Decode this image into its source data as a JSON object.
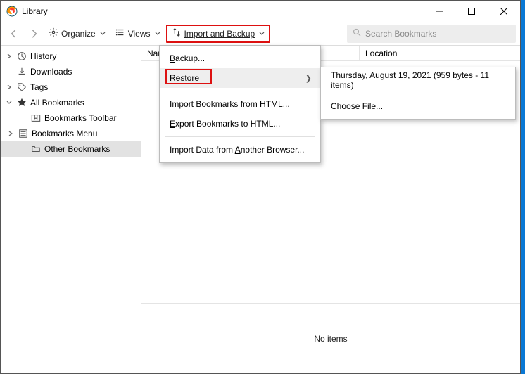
{
  "window": {
    "title": "Library"
  },
  "toolbar": {
    "organize": "Organize",
    "views": "Views",
    "import_backup": "Import and Backup",
    "search_placeholder": "Search Bookmarks"
  },
  "sidebar": {
    "history": "History",
    "downloads": "Downloads",
    "tags": "Tags",
    "all_bookmarks": "All Bookmarks",
    "bm_toolbar": "Bookmarks Toolbar",
    "bm_menu": "Bookmarks Menu",
    "other_bm": "Other Bookmarks"
  },
  "columns": {
    "name": "Name",
    "location": "Location"
  },
  "empty_text": "No items",
  "menu1": {
    "backup": "Backup...",
    "restore": "Restore",
    "import_html": "Import Bookmarks from HTML...",
    "export_html": "Export Bookmarks to HTML...",
    "import_other": "Import Data from Another Browser..."
  },
  "menu2": {
    "entry": "Thursday, August 19, 2021 (959 bytes - 11 items)",
    "choose": "Choose File..."
  }
}
